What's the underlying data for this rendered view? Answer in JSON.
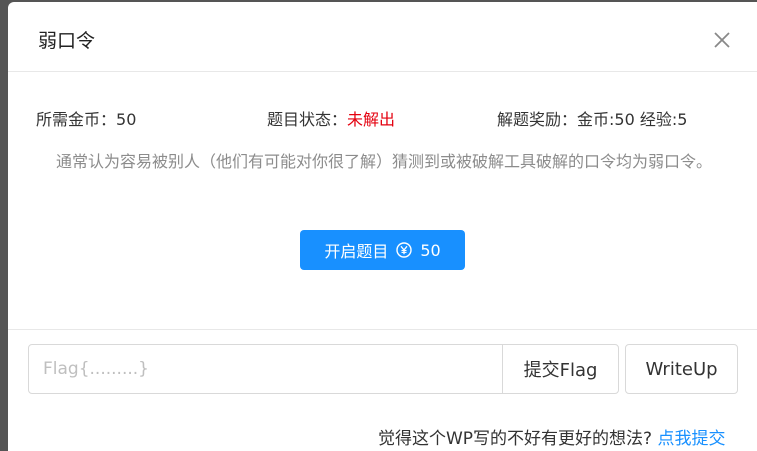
{
  "modal": {
    "title": "弱口令"
  },
  "info": {
    "coin_label": "所需金币：",
    "coin_value": "50",
    "status_label": "题目状态：",
    "status_value": "未解出",
    "reward_label": "解题奖励：",
    "reward_value": "金币:50 经验:5"
  },
  "description": "通常认为容易被别人（他们有可能对你很了解）猜测到或被破解工具破解的口令均为弱口令。",
  "start_button": {
    "label": "开启题目",
    "cost": "50",
    "icon": "yen-circle-icon"
  },
  "flag_form": {
    "placeholder": "Flag{.........}",
    "value": "",
    "submit_label": "提交Flag",
    "writeup_label": "WriteUp"
  },
  "feedback": {
    "question": "觉得这个WP写的不好有更好的想法?",
    "link_label": "点我提交"
  },
  "colors": {
    "primary": "#1890ff",
    "status_red": "#e4000f",
    "description_gray": "#8c8c8c"
  }
}
